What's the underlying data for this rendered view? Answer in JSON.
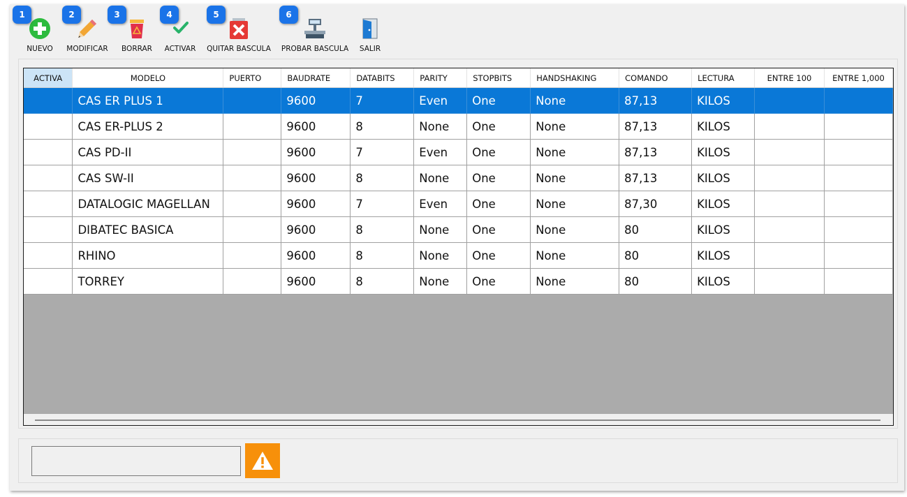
{
  "toolbar": {
    "buttons": [
      {
        "badge": "1",
        "label": "NUEVO",
        "icon": "add-circle-icon"
      },
      {
        "badge": "2",
        "label": "MODIFICAR",
        "icon": "pencil-icon"
      },
      {
        "badge": "3",
        "label": "BORRAR",
        "icon": "trash-bin-icon"
      },
      {
        "badge": "4",
        "label": "ACTIVAR",
        "icon": "checkmark-icon"
      },
      {
        "badge": "5",
        "label": "QUITAR BASCULA",
        "icon": "red-x-icon"
      },
      {
        "badge": "6",
        "label": "PROBAR BASCULA",
        "icon": "scale-icon"
      },
      {
        "badge": "",
        "label": "SALIR",
        "icon": "exit-door-icon"
      }
    ]
  },
  "table": {
    "columns": [
      "ACTIVA",
      "MODELO",
      "PUERTO",
      "BAUDRATE",
      "DATABITS",
      "PARITY",
      "STOPBITS",
      "HANDSHAKING",
      "COMANDO",
      "LECTURA",
      "ENTRE 100",
      "ENTRE 1,000"
    ],
    "rows": [
      [
        "",
        "CAS ER PLUS 1",
        "",
        "9600",
        "7",
        "Even",
        "One",
        "None",
        "87,13",
        "KILOS",
        "",
        ""
      ],
      [
        "",
        "CAS ER-PLUS 2",
        "",
        "9600",
        "8",
        "None",
        "One",
        "None",
        "87,13",
        "KILOS",
        "",
        ""
      ],
      [
        "",
        "CAS PD-II",
        "",
        "9600",
        "7",
        "Even",
        "One",
        "None",
        "87,13",
        "KILOS",
        "",
        ""
      ],
      [
        "",
        "CAS SW-II",
        "",
        "9600",
        "8",
        "None",
        "One",
        "None",
        "87,13",
        "KILOS",
        "",
        ""
      ],
      [
        "",
        "DATALOGIC MAGELLAN",
        "",
        "9600",
        "7",
        "Even",
        "One",
        "None",
        "87,30",
        "KILOS",
        "",
        ""
      ],
      [
        "",
        "DIBATEC BASICA",
        "",
        "9600",
        "8",
        "None",
        "One",
        "None",
        "80",
        "KILOS",
        "",
        ""
      ],
      [
        "",
        "RHINO",
        "",
        "9600",
        "8",
        "None",
        "One",
        "None",
        "80",
        "KILOS",
        "",
        ""
      ],
      [
        "",
        "TORREY",
        "",
        "9600",
        "8",
        "None",
        "One",
        "None",
        "80",
        "KILOS",
        "",
        ""
      ]
    ],
    "selected_row": 0
  },
  "status": {
    "message": "",
    "warning_icon": "warning-icon"
  },
  "colors": {
    "selection": "#0a78d7",
    "badge": "#1a73e8",
    "warning": "#f7900a"
  }
}
